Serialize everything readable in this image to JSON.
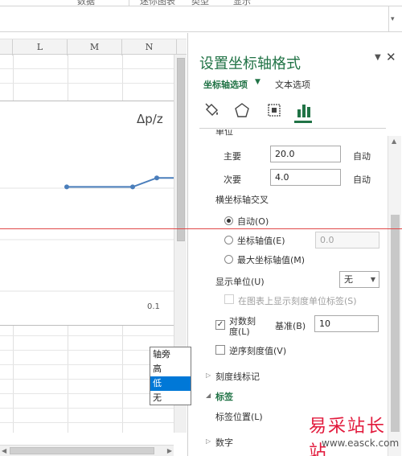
{
  "ribbon": {
    "items": [
      "数据",
      "迷你图表",
      "类型",
      "显示"
    ]
  },
  "sheet": {
    "columns": [
      "L",
      "M",
      "N"
    ]
  },
  "chart": {
    "title": "Δp/z",
    "tick_label": "0.1",
    "line_color": "#4a7ebb"
  },
  "chart_data": {
    "type": "line",
    "title": "Δp/z",
    "x": [
      1,
      2,
      3,
      4
    ],
    "series": [
      {
        "values": [
          0.62,
          0.62,
          0.66,
          0.66
        ]
      }
    ],
    "tick_labels": [
      "0.1"
    ]
  },
  "pane": {
    "title": "设置坐标轴格式",
    "tab_axis": "坐标轴选项",
    "tab_text": "文本选项",
    "icons": [
      "paint-bucket-icon",
      "pentagon-icon",
      "size-properties-icon",
      "bar-chart-icon"
    ],
    "accent": "#217346",
    "units_heading": "单位",
    "major_label": "主要",
    "major_value": "20.0",
    "major_auto": "自动",
    "minor_label": "次要",
    "minor_value": "4.0",
    "minor_auto": "自动",
    "cross_heading": "横坐标轴交叉",
    "radio_auto": "自动(O)",
    "radio_value": "坐标轴值(E)",
    "radio_value_input": "0.0",
    "radio_max": "最大坐标轴值(M)",
    "display_units_label": "显示单位(U)",
    "display_units_value": "无",
    "show_units_label": "在图表上显示刻度单位标签(S)",
    "log_scale_label_1": "对数刻",
    "log_scale_label_2": "度(L)",
    "log_base_label": "基准(B)",
    "log_base_value": "10",
    "reverse_label": "逆序刻度值(V)",
    "tick_marks_section": "刻度线标记",
    "labels_section": "标签",
    "label_position_label": "标签位置(L)",
    "number_section": "数字",
    "dropdown_options": [
      "轴旁",
      "高",
      "低",
      "无"
    ],
    "dropdown_selected": "低"
  },
  "watermark": {
    "line1": "易采站长站",
    "line2": "www.easck.com"
  }
}
